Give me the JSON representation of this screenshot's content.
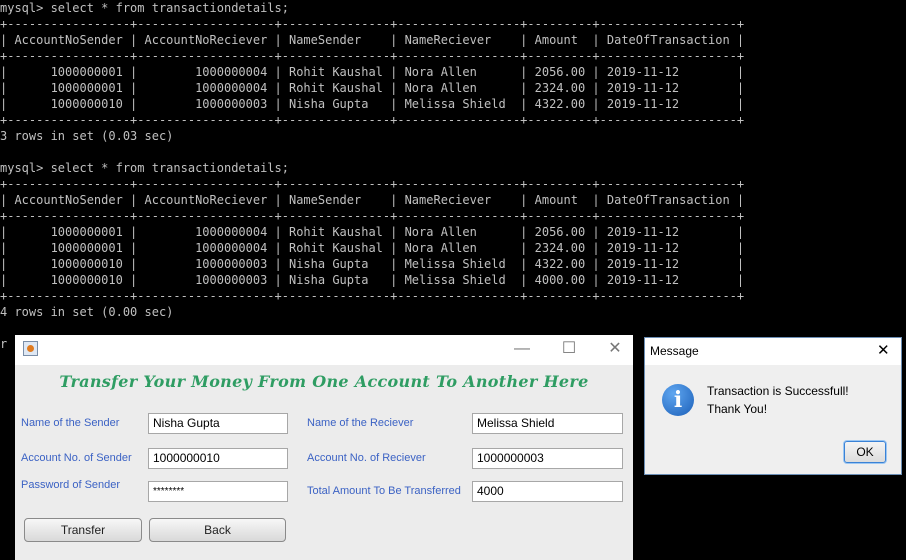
{
  "terminal": {
    "lines": [
      "mysql> select * from transactiondetails;",
      "+-----------------+-------------------+---------------+-----------------+---------+-------------------+",
      "| AccountNoSender | AccountNoReciever | NameSender    | NameReciever    | Amount  | DateOfTransaction |",
      "+-----------------+-------------------+---------------+-----------------+---------+-------------------+",
      "|      1000000001 |        1000000004 | Rohit Kaushal | Nora Allen      | 2056.00 | 2019-11-12        |",
      "|      1000000001 |        1000000004 | Rohit Kaushal | Nora Allen      | 2324.00 | 2019-11-12        |",
      "|      1000000010 |        1000000003 | Nisha Gupta   | Melissa Shield  | 4322.00 | 2019-11-12        |",
      "+-----------------+-------------------+---------------+-----------------+---------+-------------------+",
      "3 rows in set (0.03 sec)",
      "",
      "mysql> select * from transactiondetails;",
      "+-----------------+-------------------+---------------+-----------------+---------+-------------------+",
      "| AccountNoSender | AccountNoReciever | NameSender    | NameReciever    | Amount  | DateOfTransaction |",
      "+-----------------+-------------------+---------------+-----------------+---------+-------------------+",
      "|      1000000001 |        1000000004 | Rohit Kaushal | Nora Allen      | 2056.00 | 2019-11-12        |",
      "|      1000000001 |        1000000004 | Rohit Kaushal | Nora Allen      | 2324.00 | 2019-11-12        |",
      "|      1000000010 |        1000000003 | Nisha Gupta   | Melissa Shield  | 4322.00 | 2019-11-12        |",
      "|      1000000010 |        1000000003 | Nisha Gupta   | Melissa Shield  | 4000.00 | 2019-11-12        |",
      "+-----------------+-------------------+---------------+-----------------+---------+-------------------+",
      "4 rows in set (0.00 sec)",
      "",
      "r"
    ]
  },
  "transfer_window": {
    "icon": "java-coffee-icon",
    "controls": {
      "minimize": "—",
      "maximize": "☐",
      "close": "✕"
    },
    "heading": "Transfer Your Money From One Account To Another Here",
    "fields": {
      "sender_name_label": "Name of the Sender",
      "sender_name_value": "Nisha Gupta",
      "receiver_name_label": "Name of the Reciever",
      "receiver_name_value": "Melissa Shield",
      "sender_account_label": "Account No. of Sender",
      "sender_account_value": "1000000010",
      "receiver_account_label": "Account No. of Reciever",
      "receiver_account_value": "1000000003",
      "sender_password_label": "Password of Sender",
      "sender_password_value": "********",
      "amount_label": "Total Amount To Be Transferred",
      "amount_value": "4000"
    },
    "buttons": {
      "transfer": "Transfer",
      "back": "Back"
    }
  },
  "message_dialog": {
    "title": "Message",
    "close": "✕",
    "icon": "info-icon",
    "icon_glyph": "i",
    "line1": "Transaction is Successfull!",
    "line2": "Thank You!",
    "ok": "OK"
  },
  "colors": {
    "heading": "#2f9d63",
    "label": "#3b62c4",
    "terminal_text": "#c0c0c0",
    "terminal_bg": "#000000"
  }
}
